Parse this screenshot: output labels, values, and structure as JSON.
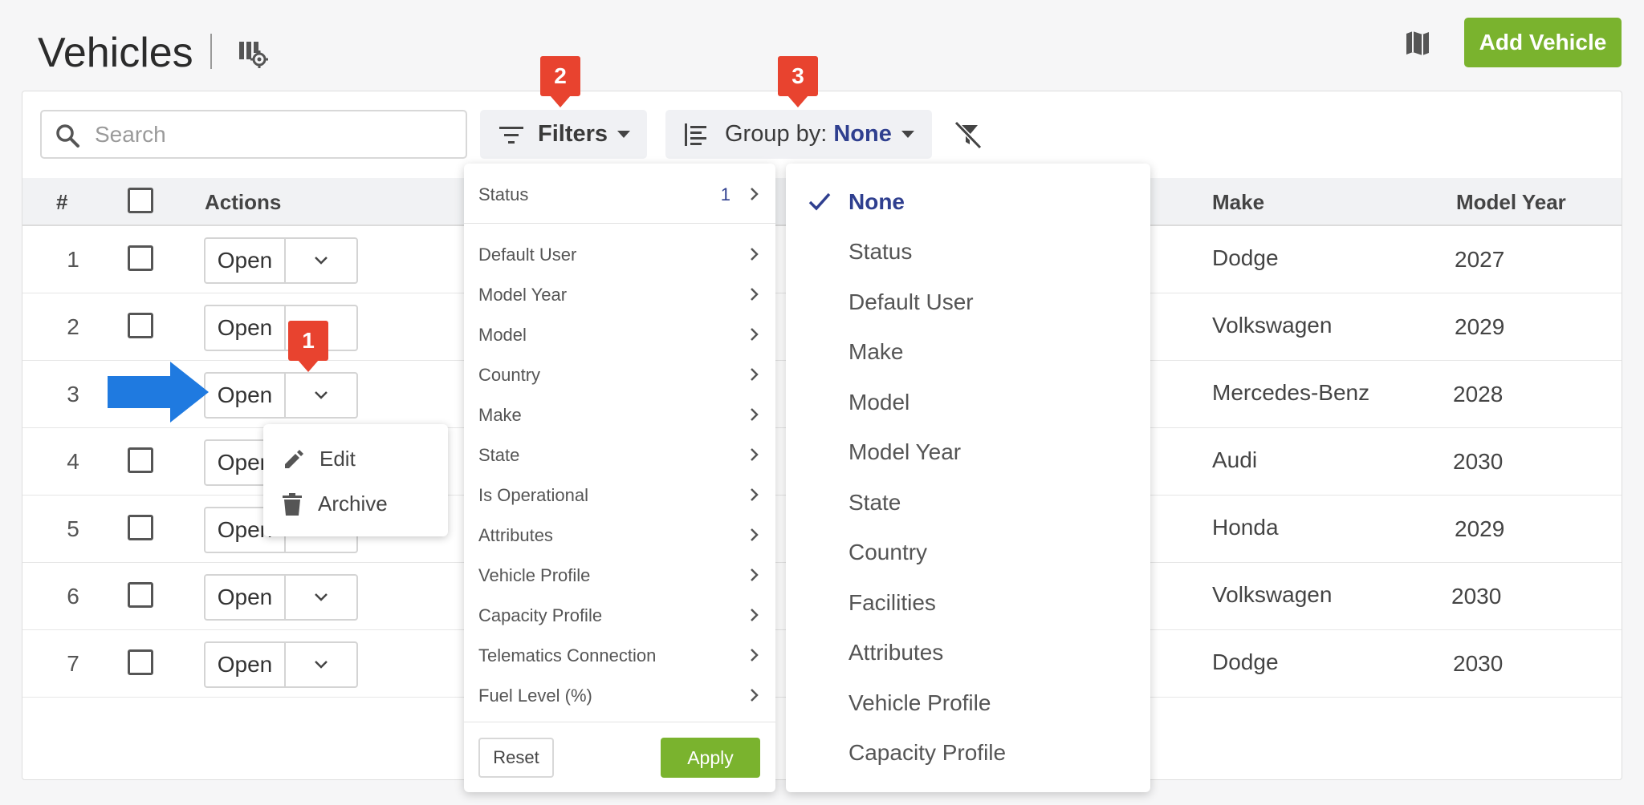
{
  "page": {
    "title": "Vehicles",
    "add_button": "Add Vehicle"
  },
  "toolbar": {
    "search_placeholder": "Search",
    "filters_label": "Filters",
    "groupby_label": "Group by:",
    "groupby_value": "None"
  },
  "table": {
    "headers": {
      "num": "#",
      "actions": "Actions",
      "make": "Make",
      "model_year": "Model Year"
    },
    "open_label": "Open",
    "rows": [
      {
        "num": "1",
        "make": "Dodge",
        "year": "2027"
      },
      {
        "num": "2",
        "make": "Volkswagen",
        "year": "2029"
      },
      {
        "num": "3",
        "make": "Mercedes-Benz",
        "year": "2028"
      },
      {
        "num": "4",
        "make": "Audi",
        "year": "2030"
      },
      {
        "num": "5",
        "make": "Honda",
        "year": "2029"
      },
      {
        "num": "6",
        "make": "Volkswagen",
        "year": "2030"
      },
      {
        "num": "7",
        "make": "Dodge",
        "year": "2030"
      }
    ]
  },
  "action_menu": {
    "edit": "Edit",
    "archive": "Archive"
  },
  "filters_panel": {
    "status": {
      "label": "Status",
      "count": "1"
    },
    "items": [
      "Default User",
      "Model Year",
      "Model",
      "Country",
      "Make",
      "State",
      "Is Operational",
      "Attributes",
      "Vehicle Profile",
      "Capacity Profile",
      "Telematics Connection",
      "Fuel Level (%)"
    ],
    "reset": "Reset",
    "apply": "Apply"
  },
  "groupby_panel": {
    "options": [
      "None",
      "Status",
      "Default User",
      "Make",
      "Model",
      "Model Year",
      "State",
      "Country",
      "Facilities",
      "Attributes",
      "Vehicle Profile",
      "Capacity Profile"
    ],
    "selected": "None"
  },
  "annotations": {
    "badge_1": "1",
    "badge_2": "2",
    "badge_3": "3"
  },
  "colors": {
    "accent_green": "#7ab32e",
    "link_blue": "#2f3f8f",
    "badge_red": "#e8432f",
    "pointer_blue": "#1f7ae0"
  }
}
